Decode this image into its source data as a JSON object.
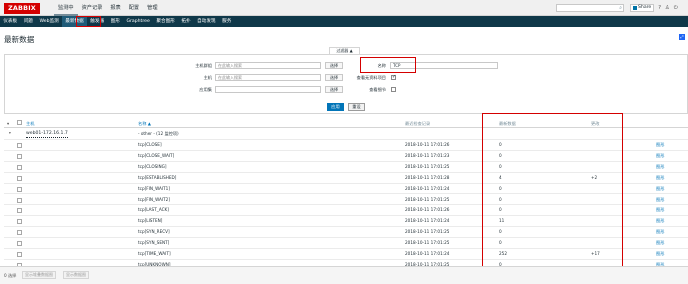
{
  "app": {
    "logo": "ZABBIX"
  },
  "topnav": [
    "监测中",
    "资产记录",
    "报表",
    "配置",
    "管理"
  ],
  "topbar": {
    "share_label": "Share",
    "help": "?",
    "user": "♙",
    "power": "⏻"
  },
  "subnav": [
    "仪表板",
    "问题",
    "Web监测",
    "最新数据",
    "触发器",
    "图形",
    "Graphtree",
    "聚合图形",
    "拓扑",
    "自动发现",
    "服务"
  ],
  "page_title": "最新数据",
  "filter": {
    "tab_label": "过滤器 ▲",
    "host_group_label": "主机群组",
    "host_group_placeholder": "在此输入搜索",
    "host_label": "主机",
    "host_placeholder": "在此输入搜索",
    "application_label": "应用集",
    "select_label": "选择",
    "name_label": "名称",
    "name_value": "TCP",
    "show_items_label": "查看无资料项目",
    "show_details_label": "查看细节",
    "show_items_checked": true,
    "show_details_checked": false,
    "apply": "应用",
    "reset": "重设"
  },
  "table": {
    "headers": {
      "host": "主机",
      "name": "名称 ▲",
      "last_check": "最近检查记录",
      "last_value": "最新数据",
      "change": "更改"
    },
    "group": {
      "host": "web01-172.16.1.7",
      "label": "- other - (12 监控项)"
    },
    "graph_label": "图形",
    "rows": [
      {
        "name": "tcp[CLOSE]",
        "time": "2018-10-11 17:01:26",
        "value": "0",
        "change": ""
      },
      {
        "name": "tcp[CLOSE_WAIT]",
        "time": "2018-10-11 17:01:23",
        "value": "0",
        "change": ""
      },
      {
        "name": "tcp[CLOSING]",
        "time": "2018-10-11 17:01:25",
        "value": "0",
        "change": ""
      },
      {
        "name": "tcp[ESTABLISHED]",
        "time": "2018-10-11 17:01:28",
        "value": "4",
        "change": "+2"
      },
      {
        "name": "tcp[FIN_WAIT1]",
        "time": "2018-10-11 17:01:24",
        "value": "0",
        "change": ""
      },
      {
        "name": "tcp[FIN_WAIT2]",
        "time": "2018-10-11 17:01:25",
        "value": "0",
        "change": ""
      },
      {
        "name": "tcp[LAST_ACK]",
        "time": "2018-10-11 17:01:26",
        "value": "0",
        "change": ""
      },
      {
        "name": "tcp[LISTEN]",
        "time": "2018-10-11 17:01:24",
        "value": "11",
        "change": ""
      },
      {
        "name": "tcp[SYN_RECV]",
        "time": "2018-10-11 17:01:25",
        "value": "0",
        "change": ""
      },
      {
        "name": "tcp[SYN_SENT]",
        "time": "2018-10-11 17:01:25",
        "value": "0",
        "change": ""
      },
      {
        "name": "tcp[TIME_WAIT]",
        "time": "2018-10-11 17:01:24",
        "value": "252",
        "change": "+17"
      },
      {
        "name": "tcp[UNKNOWN]",
        "time": "2018-10-11 17:01:25",
        "value": "0",
        "change": ""
      }
    ]
  },
  "footer": {
    "count": "0 选择",
    "btn1": "显示堆叠数据图",
    "btn2": "显示数据图"
  },
  "colors": {
    "brand": "#d40000",
    "subnav": "#0f3849",
    "link": "#0275b8",
    "highlight": "#d40000"
  }
}
